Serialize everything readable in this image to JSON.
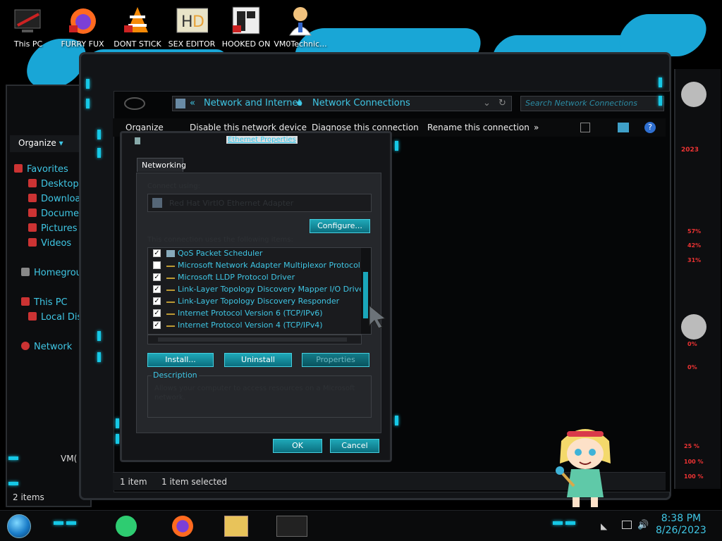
{
  "desktop_icons": [
    {
      "label": "This PC",
      "icon": "this-pc-icon"
    },
    {
      "label": "FURRY FUX",
      "icon": "firefox-icon"
    },
    {
      "label": "DONT STICK",
      "icon": "vlc-icon"
    },
    {
      "label": "SEX EDITOR",
      "icon": "hex-editor-icon"
    },
    {
      "label": "HOOKED ON",
      "icon": "app-icon"
    },
    {
      "label": "VM0Technic...",
      "icon": "doctor-icon"
    }
  ],
  "back_window": {
    "organize": "Organize",
    "sidebar": [
      "Favorites",
      "Desktop",
      "Downloa",
      "Documen",
      "Pictures",
      "Videos",
      "Homegroup",
      "This PC",
      "Local Dis",
      "Network"
    ],
    "vm_label": "VM(",
    "status": "2 items"
  },
  "main_window": {
    "breadcrumb": {
      "sep": "«",
      "parent": "Network and Internet",
      "current": "Network Connections"
    },
    "search_placeholder": "Search Network Connections",
    "commands": {
      "organize": "Organize",
      "disable": "Disable this network device",
      "diagnose": "Diagnose this connection",
      "rename": "Rename this connection",
      "more": "»"
    },
    "status": {
      "count": "1 item",
      "selected": "1 item selected"
    }
  },
  "dialog": {
    "title": "Ethernet Properties",
    "tab": "Networking",
    "connect_using_label": "Connect using:",
    "adapter": "Red Hat VirtIO Ethernet Adapter",
    "configure": "Configure...",
    "items_label": "This connection uses the following items:",
    "items": [
      {
        "label": "QoS Packet Scheduler",
        "checked": true
      },
      {
        "label": "Microsoft Network Adapter Multiplexor Protocol",
        "checked": false
      },
      {
        "label": "Microsoft LLDP Protocol Driver",
        "checked": true
      },
      {
        "label": "Link-Layer Topology Discovery Mapper I/O Driver",
        "checked": true
      },
      {
        "label": "Link-Layer Topology Discovery Responder",
        "checked": true
      },
      {
        "label": "Internet Protocol Version 6 (TCP/IPv6)",
        "checked": true
      },
      {
        "label": "Internet Protocol Version 4 (TCP/IPv4)",
        "checked": true
      }
    ],
    "install": "Install...",
    "uninstall": "Uninstall",
    "properties": "Properties",
    "description_label": "Description",
    "description": "Allows your computer to access resources on a Microsoft network.",
    "ok": "OK",
    "cancel": "Cancel"
  },
  "gadget": {
    "year": "2023",
    "stats": [
      "57%",
      "42%",
      "31%",
      "0%",
      "0%",
      "25 %",
      "100 %",
      "100 %"
    ]
  },
  "clock": {
    "time": "8:38 PM",
    "date": "8/26/2023"
  },
  "colors": {
    "accent": "#3fc6e4",
    "led": "#16c8e6",
    "alert": "#e33333"
  }
}
